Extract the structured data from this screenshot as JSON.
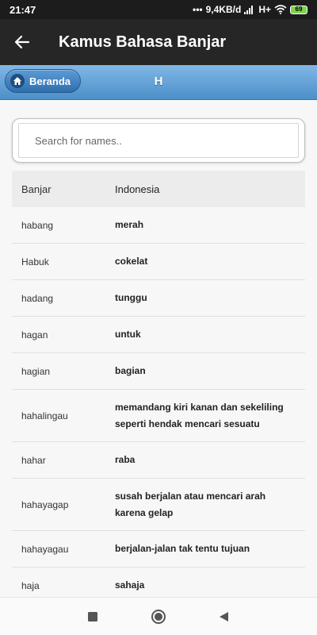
{
  "status": {
    "time": "21:47",
    "network": "9,4KB/d",
    "signal": "H+",
    "battery": "69"
  },
  "appbar": {
    "title": "Kamus Bahasa Banjar"
  },
  "header": {
    "home_label": "Beranda",
    "letter": "H"
  },
  "search": {
    "placeholder": "Search for names.."
  },
  "table": {
    "headers": [
      "Banjar",
      "Indonesia"
    ],
    "rows": [
      [
        "habang",
        "merah"
      ],
      [
        "Habuk",
        "cokelat"
      ],
      [
        "hadang",
        "tunggu"
      ],
      [
        "hagan",
        "untuk"
      ],
      [
        "hagian",
        "bagian"
      ],
      [
        "hahalingau",
        "memandang kiri kanan dan sekeliling seperti hendak mencari sesuatu"
      ],
      [
        "hahar",
        "raba"
      ],
      [
        "hahayagap",
        "susah berjalan atau mencari arah karena gelap"
      ],
      [
        "hahayagau",
        "berjalan-jalan tak tentu tujuan"
      ],
      [
        "haja",
        "sahaja"
      ]
    ]
  }
}
